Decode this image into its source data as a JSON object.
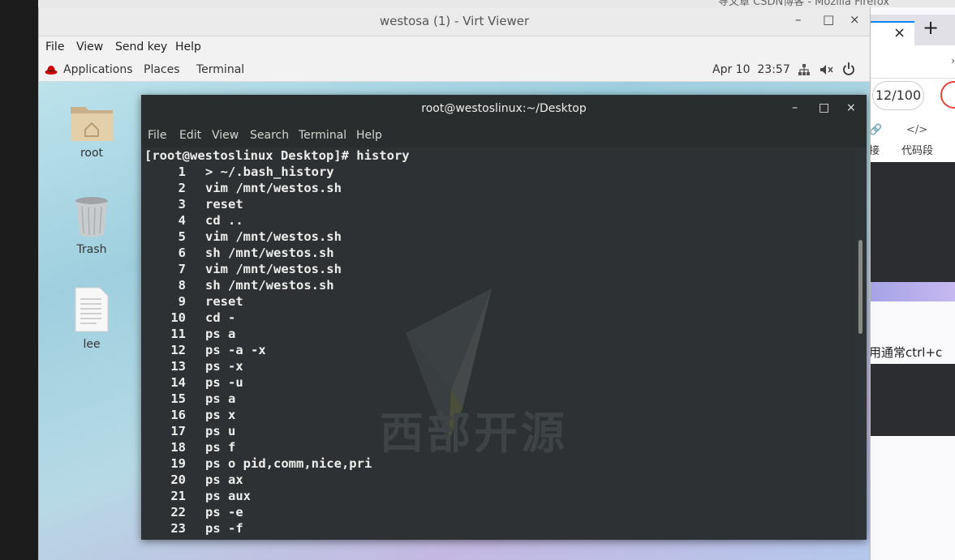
{
  "host": {
    "firefox_title_peek": "导文章 CSDN博客 - Mozilla Firefox",
    "firefox": {
      "tab_close": "×",
      "new_tab": "+",
      "url_arrow": "›",
      "page_counter": "12/100",
      "link_icon": "🔗",
      "link_label": "接",
      "code_icon": "</>",
      "code_label": "代码段",
      "body_text": "用通常ctrl+c"
    }
  },
  "virt_viewer": {
    "title": "westosa (1) - Virt Viewer",
    "minimize": "–",
    "maximize": "□",
    "close": "×",
    "menu": [
      "File",
      "View",
      "Send key",
      "Help"
    ]
  },
  "guest": {
    "topbar": {
      "applications": "Applications",
      "places": "Places",
      "terminal": "Terminal",
      "date": "Apr 10",
      "time": "23:57",
      "icons": [
        "network-icon",
        "volume-icon",
        "power-icon"
      ]
    },
    "desktop_icons": [
      {
        "label": "root",
        "icon": "home-folder-icon"
      },
      {
        "label": "Trash",
        "icon": "trash-icon"
      },
      {
        "label": "lee",
        "icon": "text-file-icon"
      }
    ],
    "terminal": {
      "title": "root@westoslinux:~/Desktop",
      "minimize": "–",
      "maximize": "□",
      "close": "×",
      "menu": [
        "File",
        "Edit",
        "View",
        "Search",
        "Terminal",
        "Help"
      ],
      "prompt_line": "[root@westoslinux Desktop]# history",
      "watermark_text": "西部开源",
      "history": [
        {
          "n": "1",
          "cmd": "> ~/.bash_history"
        },
        {
          "n": "2",
          "cmd": "vim /mnt/westos.sh"
        },
        {
          "n": "3",
          "cmd": "reset"
        },
        {
          "n": "4",
          "cmd": "cd .."
        },
        {
          "n": "5",
          "cmd": "vim /mnt/westos.sh"
        },
        {
          "n": "6",
          "cmd": "sh /mnt/westos.sh"
        },
        {
          "n": "7",
          "cmd": "vim /mnt/westos.sh"
        },
        {
          "n": "8",
          "cmd": "sh /mnt/westos.sh"
        },
        {
          "n": "9",
          "cmd": "reset"
        },
        {
          "n": "10",
          "cmd": "cd -"
        },
        {
          "n": "11",
          "cmd": "ps a"
        },
        {
          "n": "12",
          "cmd": "ps -a -x"
        },
        {
          "n": "13",
          "cmd": "ps -x"
        },
        {
          "n": "14",
          "cmd": "ps -u"
        },
        {
          "n": "15",
          "cmd": "ps a"
        },
        {
          "n": "16",
          "cmd": "ps x"
        },
        {
          "n": "17",
          "cmd": "ps u"
        },
        {
          "n": "18",
          "cmd": "ps f"
        },
        {
          "n": "19",
          "cmd": "ps o pid,comm,nice,pri"
        },
        {
          "n": "20",
          "cmd": "ps ax"
        },
        {
          "n": "21",
          "cmd": "ps aux"
        },
        {
          "n": "22",
          "cmd": "ps -e"
        },
        {
          "n": "23",
          "cmd": "ps -f"
        }
      ]
    }
  },
  "colors": {
    "terminal_bg": "#2d3133",
    "terminal_fg": "#eeeeec",
    "accent_red": "#e8453c"
  }
}
